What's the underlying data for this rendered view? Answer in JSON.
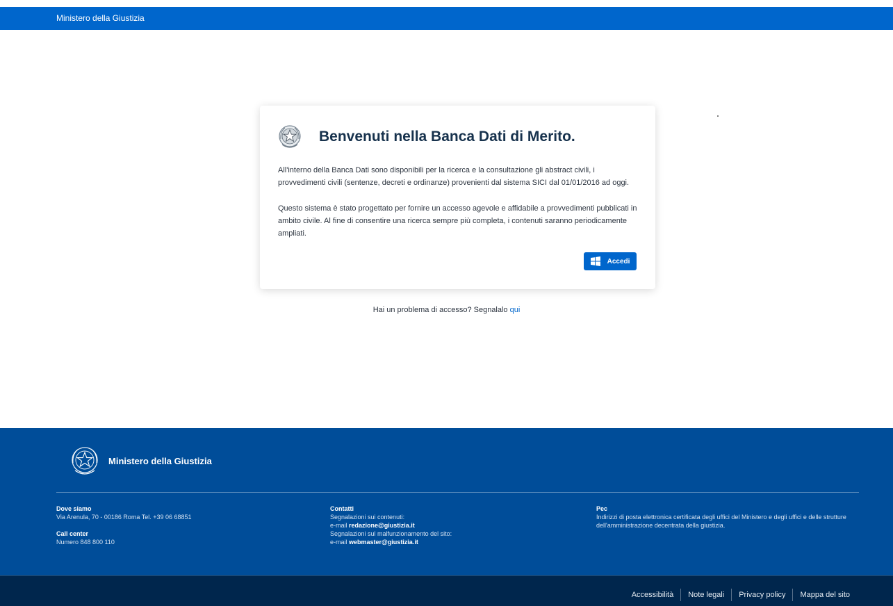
{
  "header": {
    "title": "Ministero della Giustizia"
  },
  "card": {
    "emblem": "repubblica-emblem",
    "title": "Benvenuti nella Banca Dati di Merito.",
    "paragraph1": "All'interno della Banca Dati sono disponibili per la ricerca e la consultazione gli abstract civili, i provvedimenti civili (sentenze, decreti e ordinanze) provenienti dal sistema SICI dal 01/01/2016 ad oggi.",
    "paragraph2": "Questo sistema è stato progettato per fornire un accesso agevole e affidabile a provvedimenti pubblicati in ambito civile. Al fine di consentire una ricerca sempre più completa, i contenuti saranno periodicamente ampliati.",
    "login_button": "Accedi",
    "login_icon": "windows-icon"
  },
  "problem": {
    "text": "Hai un problema di accesso? Segnalalo ",
    "link": "qui"
  },
  "footer": {
    "brand": "Ministero della Giustizia",
    "dove_siamo": {
      "heading": "Dove siamo",
      "address": "Via Arenula, 70 - 00186 Roma Tel. +39 06 68851"
    },
    "call_center": {
      "heading": "Call center",
      "number": "Numero 848 800 110"
    },
    "contatti": {
      "heading": "Contatti",
      "line1": "Segnalazioni sui contenuti:",
      "line2_prefix": "e-mail ",
      "line2_email": "redazione@giustizia.it",
      "line3": "Segnalazioni sul malfunzionamento del sito:",
      "line4_prefix": "e-mail ",
      "line4_email": "webmaster@giustizia.it"
    },
    "pec": {
      "heading": "Pec",
      "text": "Indirizzi di posta elettronica certificata degli uffici del Ministero e degli uffici e delle strutture dell'amministrazione decentrata della giustizia."
    }
  },
  "bottom_links": [
    "Accessibilità",
    "Note legali",
    "Privacy policy",
    "Mappa del sito"
  ],
  "colors": {
    "primary": "#0066cc",
    "footer": "#004d99",
    "bottom_bar": "#00264d",
    "title": "#17324d"
  }
}
